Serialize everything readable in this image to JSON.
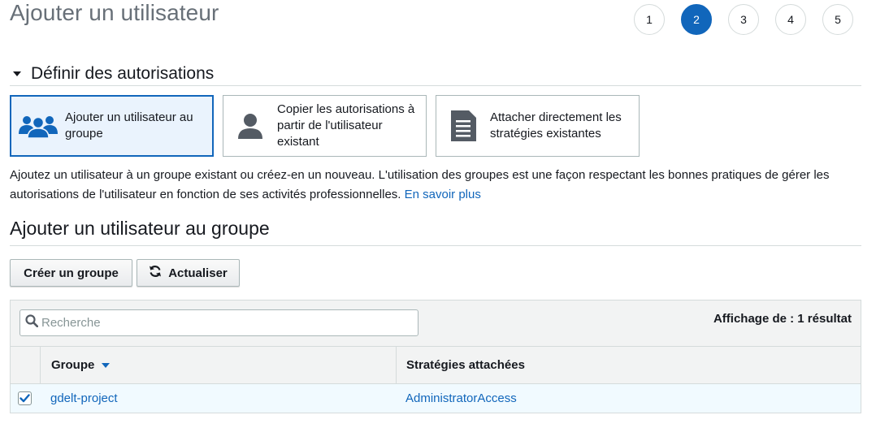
{
  "page": {
    "title": "Ajouter un utilisateur"
  },
  "steps": [
    {
      "label": "1",
      "active": false
    },
    {
      "label": "2",
      "active": true
    },
    {
      "label": "3",
      "active": false
    },
    {
      "label": "4",
      "active": false
    },
    {
      "label": "5",
      "active": false
    }
  ],
  "permissions": {
    "section_title": "Définir des autorisations",
    "options": [
      {
        "label": "Ajouter un utilisateur au groupe",
        "icon": "users-group-icon",
        "selected": true
      },
      {
        "label": "Copier les autorisations à partir de l'utilisateur existant",
        "icon": "user-icon",
        "selected": false
      },
      {
        "label": "Attacher directement les stratégies existantes",
        "icon": "document-icon",
        "selected": false
      }
    ],
    "description": "Ajoutez un utilisateur à un groupe existant ou créez-en un nouveau. L'utilisation des groupes est une façon respectant les bonnes pratiques de gérer les autorisations de l'utilisateur en fonction de ses activités professionnelles.",
    "learn_more": "En savoir plus"
  },
  "group_section": {
    "title": "Ajouter un utilisateur au groupe",
    "create_group_label": "Créer un groupe",
    "refresh_label": "Actualiser",
    "search_placeholder": "Recherche",
    "result_count": "Affichage de : 1 résultat",
    "columns": {
      "group": "Groupe",
      "policies": "Stratégies attachées"
    },
    "rows": [
      {
        "group": "gdelt-project",
        "policies": "AdministratorAccess",
        "checked": true
      }
    ]
  },
  "colors": {
    "accent": "#1166bb",
    "selected_bg": "#eaf3fd",
    "row_bg": "#f1faff",
    "header_bg": "#f2f3f3",
    "border": "#d5dbdb"
  }
}
